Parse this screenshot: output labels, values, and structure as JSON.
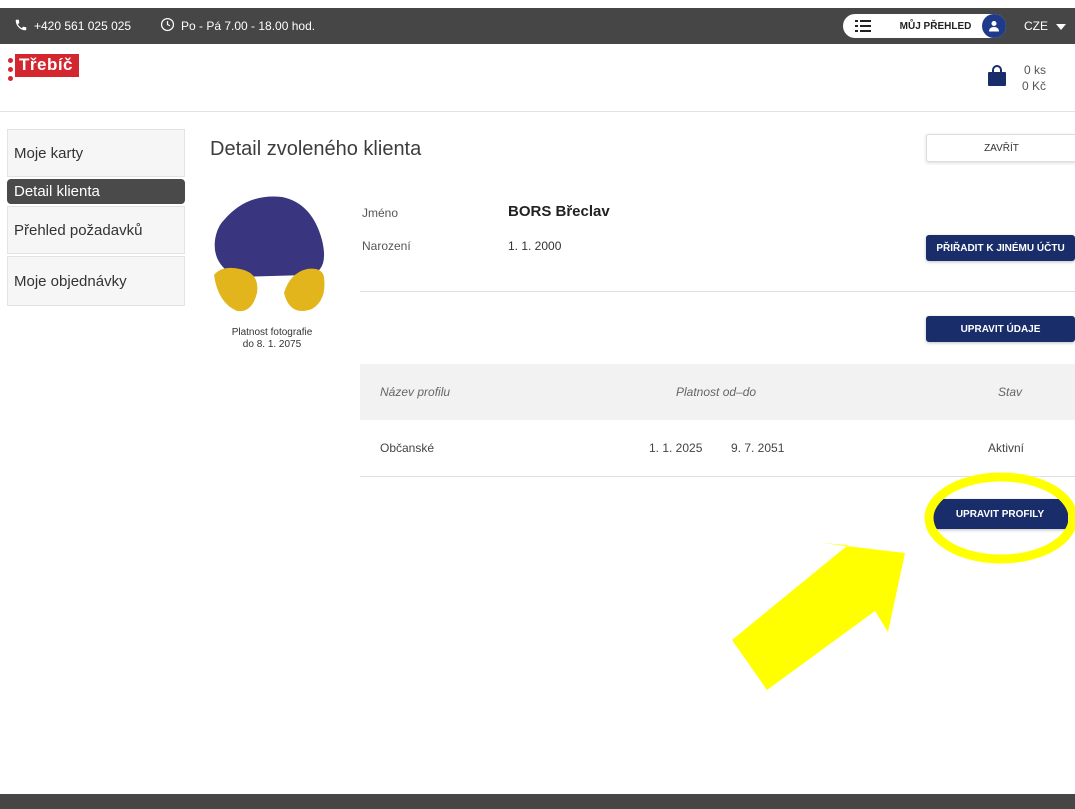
{
  "topbar": {
    "phone": "+420 561 025 025",
    "hours": "Po - Pá 7.00 - 18.00 hod.",
    "overview_label": "MŮJ PŘEHLED",
    "language": "CZE"
  },
  "header": {
    "logo_text": "Třebíč",
    "cart_count": "0 ks",
    "cart_price": "0 Kč"
  },
  "sidebar": {
    "items": [
      {
        "label": "Moje karty"
      },
      {
        "label": "Detail klienta"
      },
      {
        "label": "Přehled požadavků"
      },
      {
        "label": "Moje objednávky"
      }
    ]
  },
  "main": {
    "title": "Detail zvoleného klienta",
    "close_label": "ZAVŘÍT",
    "photo_caption_line1": "Platnost fotografie",
    "photo_caption_line2": "do 8. 1. 2075",
    "name_label": "Jméno",
    "name_value": "BORS Břeclav",
    "birth_label": "Narození",
    "birth_value": "1. 1. 2000",
    "assign_label": "PŘIŘADIT K JINÉMU ÚČTU",
    "edit_data_label": "UPRAVIT ÚDAJE",
    "edit_profiles_label": "UPRAVIT PROFILY"
  },
  "profiles_table": {
    "headers": [
      "Název profilu",
      "Platnost od–do",
      "Stav"
    ],
    "rows": [
      {
        "name": "Občanské",
        "valid_from": "1. 1. 2025",
        "valid_to": "9. 7. 2051",
        "status": "Aktivní"
      }
    ]
  },
  "colors": {
    "topbar": "#464646",
    "brand_red": "#d3262e",
    "navy": "#1a2d6b",
    "avatar_blue": "#39357e",
    "avatar_yellow": "#e3b51d",
    "annotation": "#ffff00"
  },
  "icons": {
    "phone": "phone-icon",
    "clock": "clock-icon",
    "menu": "menu-icon",
    "user": "user-icon",
    "dropdown": "caret-down-icon",
    "cart": "shopping-bag-icon"
  }
}
